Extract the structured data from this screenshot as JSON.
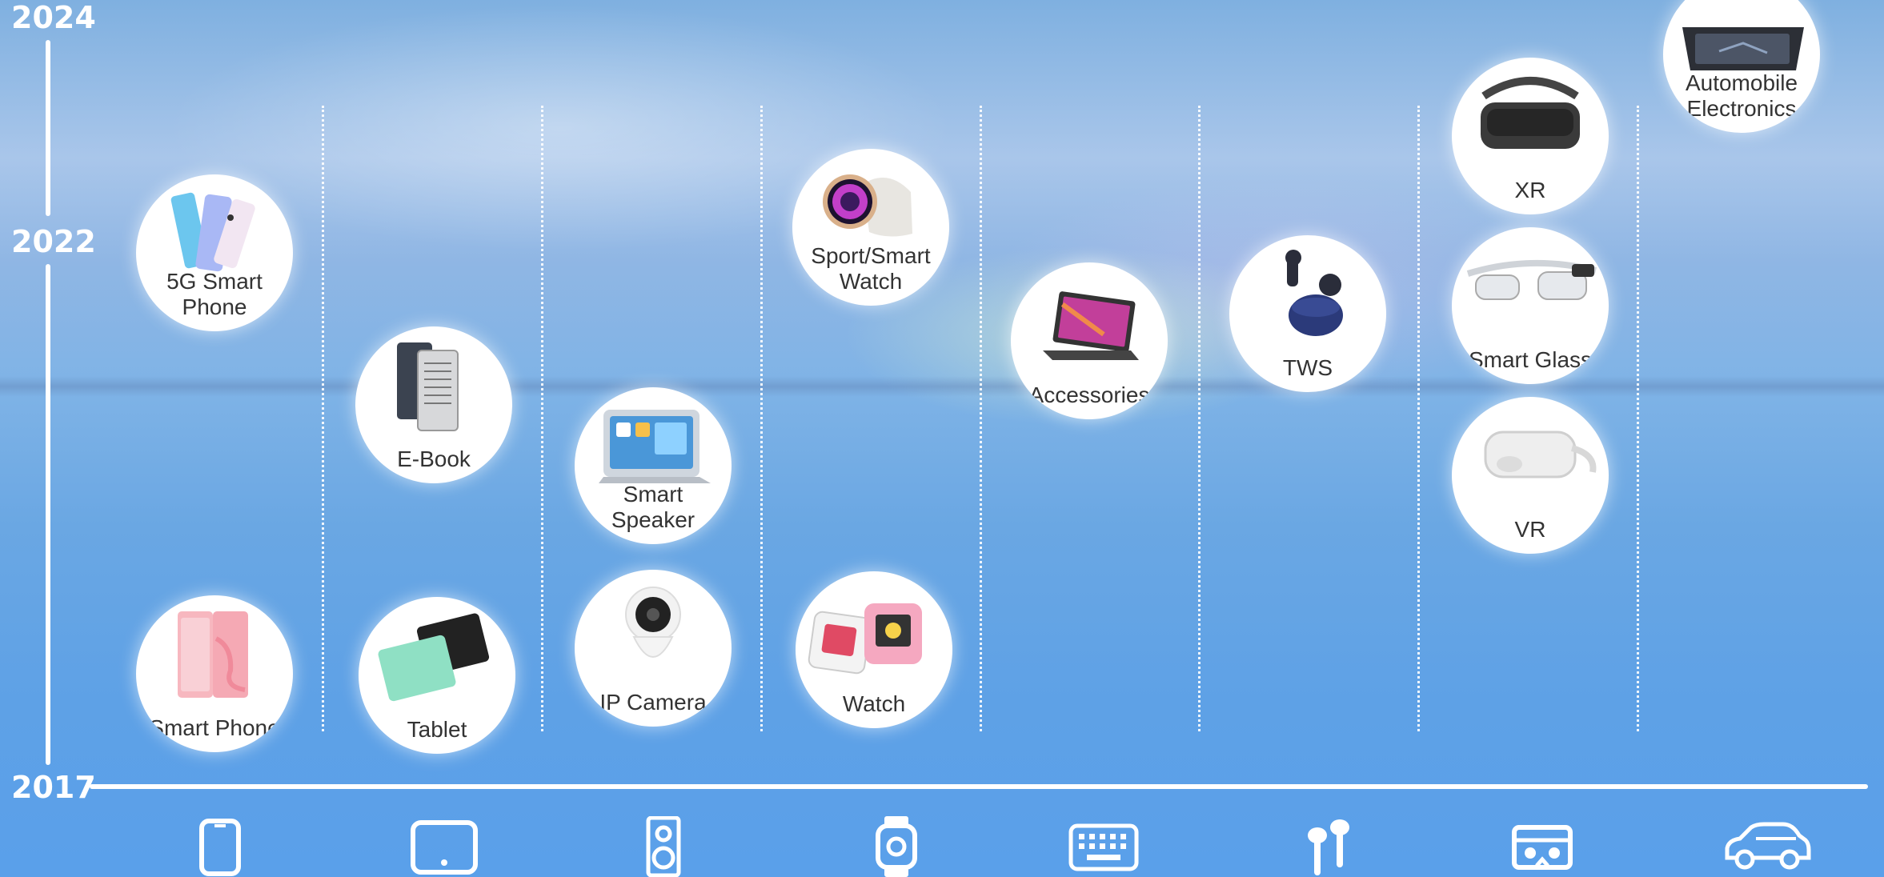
{
  "timeline": {
    "years": [
      "2024",
      "2022",
      "2017"
    ]
  },
  "products": {
    "smart_phone": "Smart Phone",
    "g5_smart_phone": "5G Smart Phone",
    "tablet": "Tablet",
    "ebook": "E-Book",
    "ip_camera": "IP Camera",
    "smart_speaker": "Smart Speaker",
    "watch": "Watch",
    "sport_smart_watch": "Sport/Smart Watch",
    "accessories": "Accessories",
    "tws": "TWS",
    "xr": "XR",
    "smart_glass": "Smart Glass",
    "vr": "VR",
    "automobile_electronics": "Automobile Electronics"
  },
  "categories": [
    {
      "icon": "phone-icon"
    },
    {
      "icon": "tablet-icon"
    },
    {
      "icon": "speaker-icon"
    },
    {
      "icon": "watch-icon"
    },
    {
      "icon": "keyboard-icon"
    },
    {
      "icon": "earbuds-icon"
    },
    {
      "icon": "vr-headset-icon"
    },
    {
      "icon": "car-icon"
    }
  ],
  "colors": {
    "label": "#333333",
    "axis": "#ffffff",
    "sky": "#6aa7e3"
  }
}
